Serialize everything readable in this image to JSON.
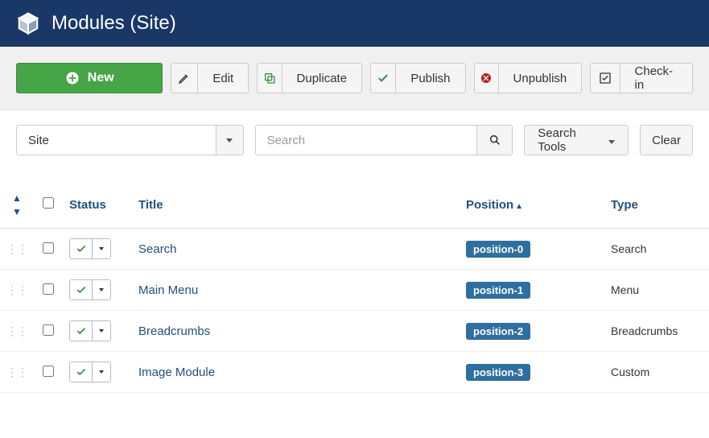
{
  "header": {
    "title": "Modules (Site)"
  },
  "toolbar": {
    "new_label": "New",
    "edit_label": "Edit",
    "duplicate_label": "Duplicate",
    "publish_label": "Publish",
    "unpublish_label": "Unpublish",
    "checkin_label": "Check-in"
  },
  "filter": {
    "site_select": "Site",
    "search_placeholder": "Search",
    "tools_label": "Search Tools",
    "clear_label": "Clear"
  },
  "columns": {
    "status": "Status",
    "title": "Title",
    "position": "Position",
    "type": "Type"
  },
  "rows": [
    {
      "title": "Search",
      "position": "position-0",
      "type": "Search"
    },
    {
      "title": "Main Menu",
      "position": "position-1",
      "type": "Menu"
    },
    {
      "title": "Breadcrumbs",
      "position": "position-2",
      "type": "Breadcrumbs"
    },
    {
      "title": "Image Module",
      "position": "position-3",
      "type": "Custom"
    }
  ]
}
